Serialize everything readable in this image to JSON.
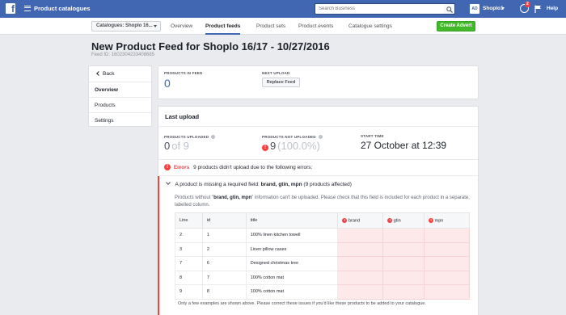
{
  "topbar": {
    "brand_icon": "facebook-logo",
    "app_title": "Product catalogues",
    "search_placeholder": "Search Business",
    "account_avatar_text": "AD",
    "account_name": "Shoplo1",
    "notification_count": "2",
    "help_label": "Help",
    "bar_color": "#4267b2"
  },
  "subnav": {
    "catalogue_select": "Catalogues: Shoplo 16...",
    "tabs": [
      {
        "label": "Overview",
        "active": false
      },
      {
        "label": "Product feeds",
        "active": true
      },
      {
        "label": "Product sets",
        "active": false
      },
      {
        "label": "Product events",
        "active": false
      },
      {
        "label": "Catalogue settings",
        "active": false
      }
    ],
    "create_button": "Create Advert",
    "create_button_color": "#42b72a"
  },
  "header": {
    "title": "New Product Feed for Shoplo 16/17 - 10/27/2016",
    "feed_id": "Feed ID: 1602304233408685"
  },
  "leftnav": {
    "back_label": "Back",
    "items": [
      {
        "label": "Overview",
        "active": true
      },
      {
        "label": "Products",
        "active": false
      },
      {
        "label": "Settings",
        "active": false
      }
    ]
  },
  "summary": {
    "products_in_feed_label": "PRODUCTS IN FEED",
    "products_in_feed_value": "0",
    "next_upload_label": "NEXT UPLOAD",
    "replace_feed_button": "Replace Feed"
  },
  "last_upload": {
    "title": "Last upload",
    "uploaded_label": "PRODUCTS UPLOADED",
    "uploaded_value": "0",
    "uploaded_suffix": "of 9",
    "not_uploaded_label": "PRODUCTS NOT UPLOADED",
    "not_uploaded_value": "9",
    "not_uploaded_pct": "(100.0%)",
    "start_time_label": "START TIME",
    "start_time_value": "27 October at 12:39",
    "errors_label": "Errors",
    "errors_text": "9 products didn't upload due to the following errors:",
    "error_color": "#fa3e3e"
  },
  "error_detail": {
    "heading_prefix": "A product is missing a required field: ",
    "heading_fields": "brand, gtin, mpn",
    "heading_suffix": " (9 products affected)",
    "desc_prefix": "Products without \"",
    "desc_fields": "brand, gtin, mpn",
    "desc_suffix": "\" information can't be uploaded. Please check that this field is included for each product in a separate, labelled column.",
    "columns": [
      "Line",
      "id",
      "title",
      "brand",
      "gtin",
      "mpn"
    ],
    "rows": [
      {
        "line": "2",
        "id": "1",
        "title": "100% linen kitchen towell"
      },
      {
        "line": "3",
        "id": "2",
        "title": "Linen pillow cases"
      },
      {
        "line": "7",
        "id": "6",
        "title": "Designed christmas tree"
      },
      {
        "line": "8",
        "id": "7",
        "title": "100% cotton mat"
      },
      {
        "line": "9",
        "id": "8",
        "title": "100% cotton mat"
      }
    ],
    "footer_note": "Only a few examples are shown above. Please correct these issues if you'd like these products to be added to your catalogue."
  }
}
